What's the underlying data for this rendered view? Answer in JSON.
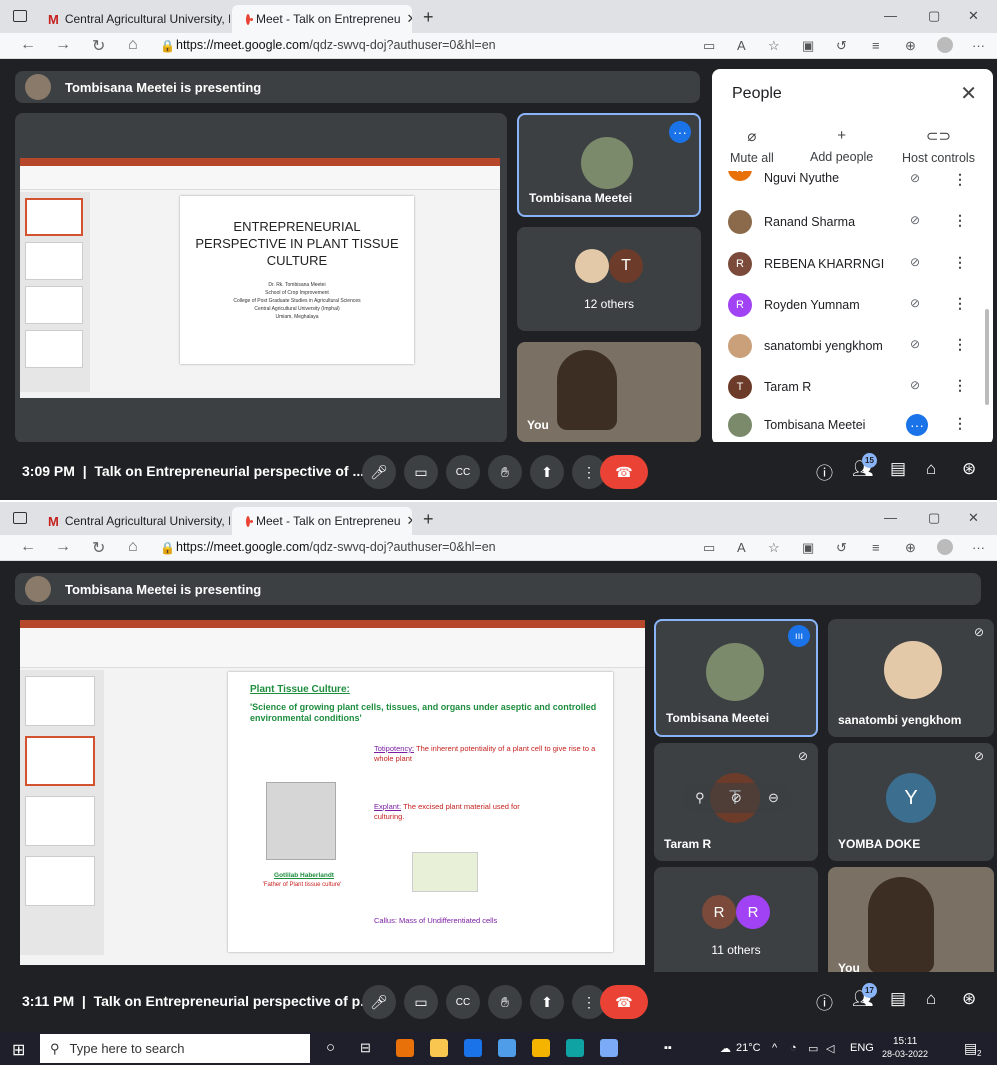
{
  "browser": {
    "tab1_title": "Central Agricultural University, I",
    "tab2_title": "Meet - Talk on Entrepreneu",
    "url_domain": "https://meet.google.com",
    "url_path": "/qdz-swvq-doj?authuser=0&hl=en"
  },
  "meet1": {
    "presenting": "Tombisana Meetei is presenting",
    "slide_title": "ENTREPRENEURIAL PERSPECTIVE IN PLANT TISSUE CULTURE",
    "slide_lines": [
      "Dr. Rk. Tombisana Meetei",
      "School of Crop Improvement",
      "College of Post Graduate Studies in Agricultural Sciences",
      "Central Agricultural University (Imphal)",
      "Umiam, Meghalaya"
    ],
    "tile_presenter": "Tombisana Meetei",
    "tile_others_letter": "T",
    "tile_others": "12 others",
    "tile_you": "You",
    "time": "3:09 PM",
    "meeting_title": "Talk on Entrepreneurial perspective of ...",
    "people_count": "15"
  },
  "people_panel": {
    "title": "People",
    "mute_all": "Mute all",
    "add_people": "Add people",
    "host_controls": "Host controls",
    "list": [
      {
        "name": "Nguvi Nyuthe",
        "letter": "N",
        "color": "#e8710a"
      },
      {
        "name": "Ranand Sharma",
        "letter": "",
        "color": "#8a6a4a"
      },
      {
        "name": "REBENA KHARRNGI",
        "letter": "R",
        "color": "#7b4a3a"
      },
      {
        "name": "Royden Yumnam",
        "letter": "R",
        "color": "#a142f4"
      },
      {
        "name": "sanatombi yengkhom",
        "letter": "",
        "color": "#c9a07a"
      },
      {
        "name": "Taram R",
        "letter": "T",
        "color": "#6d3b2a"
      },
      {
        "name": "Tombisana Meetei",
        "letter": "",
        "color": "#7a8a6a"
      }
    ]
  },
  "meet2": {
    "presenting": "Tombisana Meetei is presenting",
    "slide_heading": "Plant Tissue Culture:",
    "slide_def": "'Science of growing plant cells, tissues, and organs under aseptic and controlled environmental conditions'",
    "toti_label": "Totipotency:",
    "toti_text": "The inherent potentiality of a plant cell to give rise to a whole plant",
    "explant_label": "Explant:",
    "explant_text": "The excised plant material used for culturing.",
    "scientist_name": "Gotlilab Haberlandt",
    "scientist_caption": "'Father of Plant tissue culture'",
    "callus_text": "Callus: Mass of Undifferentiated cells",
    "tile_presenter": "Tombisana Meetei",
    "tile_sanatombi": "sanatombi yengkhom",
    "tile_taram": "Taram R",
    "tile_taram_letter": "T",
    "tile_yomba_letter": "Y",
    "tile_yomba": "YOMBA DOKE",
    "tile_others_l1": "R",
    "tile_others_l2": "R",
    "tile_others": "11 others",
    "tile_you": "You",
    "time": "3:11 PM",
    "meeting_title": "Talk on Entrepreneurial perspective of p...",
    "people_count": "17"
  },
  "taskbar": {
    "search_placeholder": "Type here to search",
    "weather": "21°C",
    "lang": "ENG",
    "clock_time": "15:11",
    "clock_date": "28-03-2022",
    "notif_count": "2"
  }
}
